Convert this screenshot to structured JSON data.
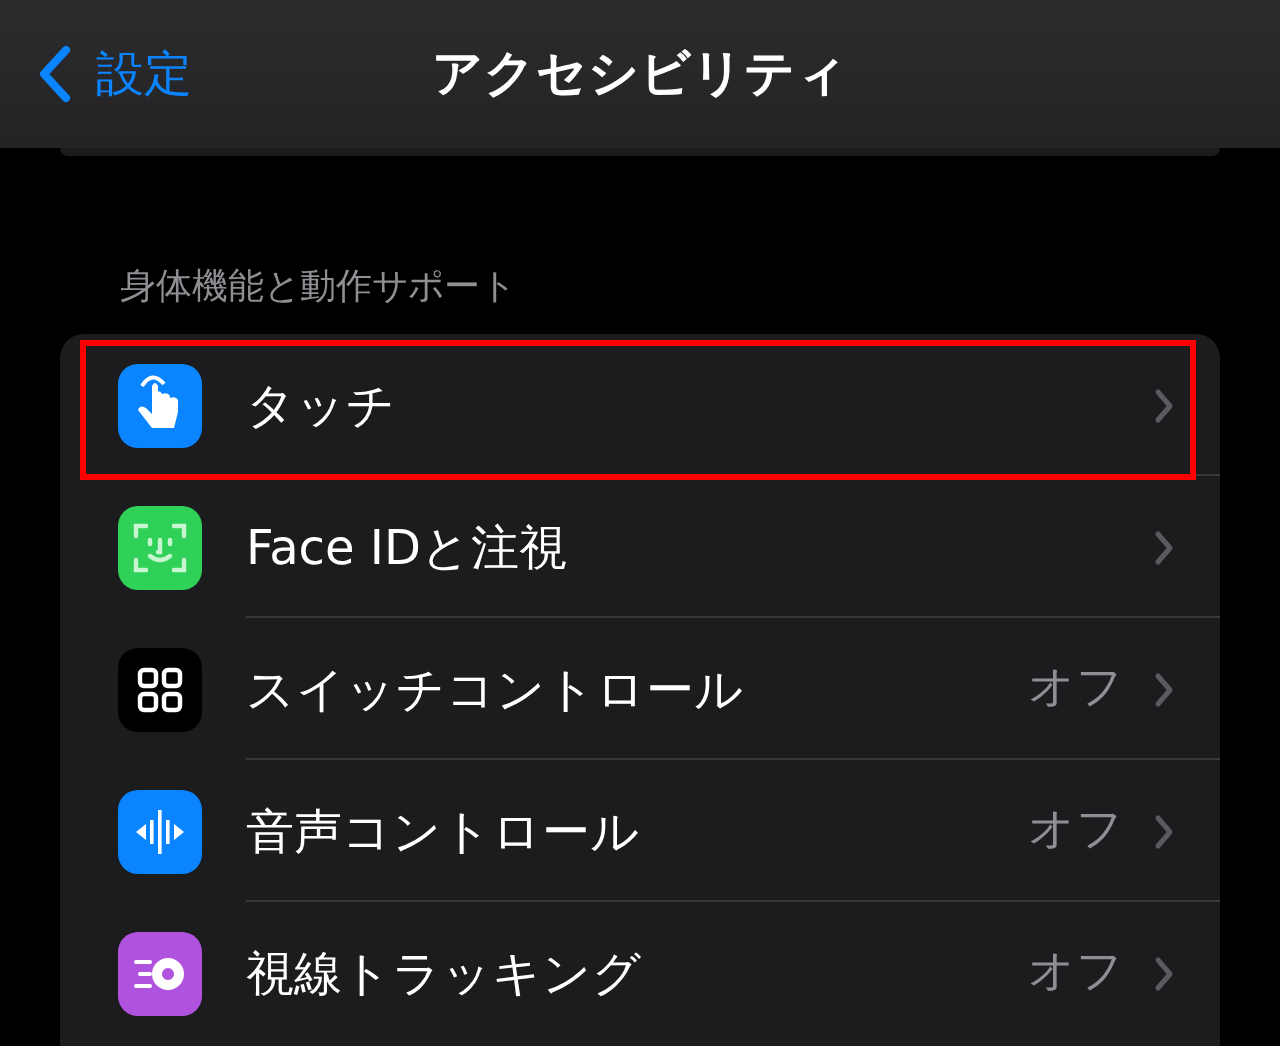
{
  "nav": {
    "back": "設定",
    "title": "アクセシビリティ"
  },
  "section": {
    "header": "身体機能と動作サポート",
    "items": [
      {
        "kind": "touch",
        "label": "タッチ",
        "highlighted": true
      },
      {
        "kind": "faceid",
        "label": "Face IDと注視",
        "highlighted": false
      },
      {
        "kind": "switch",
        "label": "スイッチコントロール",
        "value": "オフ",
        "highlighted": false
      },
      {
        "kind": "voice",
        "label": "音声コントロール",
        "value": "オフ",
        "highlighted": false
      },
      {
        "kind": "eye",
        "label": "視線トラッキング",
        "value": "オフ",
        "highlighted": false
      }
    ]
  }
}
